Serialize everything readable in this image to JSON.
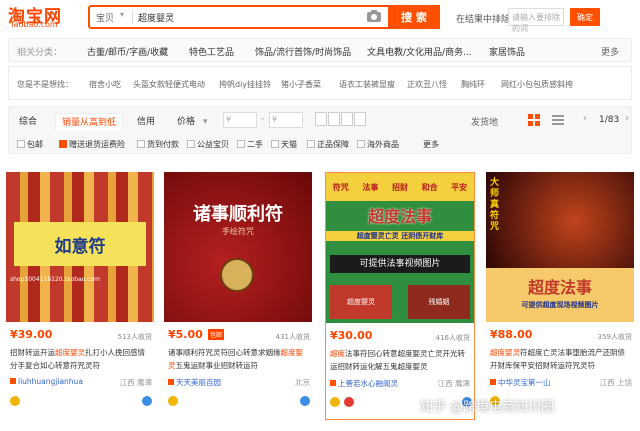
{
  "logo": {
    "main": "淘宝网",
    "sub": "Taobao.com"
  },
  "search": {
    "scope": "宝贝",
    "keyword": "超度婴灵",
    "button": "搜 索"
  },
  "within": {
    "label": "在结果中排除",
    "placeholder": "请输入要排除的词",
    "button": "确定"
  },
  "categories": [
    {
      "label": "古董/邮币/字画/收藏"
    },
    {
      "label": "特色工艺品"
    },
    {
      "label": "饰品/流行首饰/时尚饰品"
    },
    {
      "label": "文具电教/文化用品/商务..."
    },
    {
      "label": "家居饰品"
    },
    {
      "label": "更多"
    }
  ],
  "related": [
    {
      "label": "您是不是想找："
    },
    {
      "label": "宿舍小吃"
    },
    {
      "label": "头盔女款轻便式电动"
    },
    {
      "label": "挎帆diy挂挂铃"
    },
    {
      "label": "猪小子香菜"
    },
    {
      "label": "语衣工装裤显瘦"
    },
    {
      "label": "正欢丑八怪"
    },
    {
      "label": "胸纯环"
    },
    {
      "label": "网红小包包质感斜挎"
    }
  ],
  "sort": {
    "tabs": [
      {
        "label": "综合"
      },
      {
        "label": "销量从高到低"
      },
      {
        "label": "信用"
      },
      {
        "label": "价格"
      }
    ],
    "price_placeholder": "¥",
    "ship": "发货地",
    "page": "1/83"
  },
  "filters": [
    {
      "label": "包邮",
      "checked": false
    },
    {
      "label": "赠送退货运费险",
      "checked": true
    },
    {
      "label": "货到付款",
      "checked": false
    },
    {
      "label": "公益宝贝",
      "checked": false
    },
    {
      "label": "二手",
      "checked": false
    },
    {
      "label": "天猫",
      "checked": false
    },
    {
      "label": "正品保障",
      "checked": false
    },
    {
      "label": "海外商品",
      "checked": false
    },
    {
      "label": "更多",
      "checked": false
    }
  ],
  "products": [
    {
      "price": "¥39.00",
      "sales": "513人收货",
      "tag": "",
      "title_a": "招财转运开运",
      "title_hl": "超度婴灵",
      "title_b": "扎打小人挽回感情分手复合如心转意符咒灵符",
      "shop": "liuhhuangjianhua",
      "location": "江西 鹰潭",
      "image_text": "如意符",
      "image_sub": "shop1004116120.taobao.com"
    },
    {
      "price": "¥5.00",
      "sales": "431人收货",
      "tag": "包邮",
      "title_a": "诸事顺利符咒灵符回心转意求姻缘",
      "title_hl": "超度婴灵",
      "title_b": "五鬼运财事业招财转运符",
      "shop": "天天美丽百园",
      "location": "北京",
      "image_text": "诸事顺利符",
      "image_sub": "手绘符咒"
    },
    {
      "price": "¥30.00",
      "sales": "416人收货",
      "tag": "",
      "title_a": "",
      "title_hl": "超度",
      "title_b": "法事符回心转意超度婴灵亡灵开光转运招财转运化解五鬼超度婴灵",
      "shop": "上善若水心融阁灵",
      "location": "江西 鹰潭",
      "image_text": "超度法事",
      "image_sub": "可提供法事视频图片",
      "image_banner": "超度婴灵亡灵  还阴债开财库",
      "image_chars": [
        "符咒",
        "法事",
        "招财",
        "和合",
        "平安"
      ],
      "image_cap_l": "超度婴灵",
      "image_cap_r": "残婚姻"
    },
    {
      "price": "¥88.00",
      "sales": "359人收货",
      "tag": "",
      "title_a": "",
      "title_hl": "超度婴灵",
      "title_b": "符超度亡灵法事堕胎流产还阴债开财库保平安招财转运符咒灵符",
      "shop": "中华灵宝第一山",
      "location": "江西 上饶",
      "image_text": "超度法事",
      "image_sub": "可提供超度现场视频图片",
      "image_side": "大师真符咒"
    }
  ],
  "watermark": "知乎 @跨境电商知识圈",
  "colors": {
    "accent": "#ff5000",
    "price": "#ff4400",
    "link": "#3366cc"
  }
}
